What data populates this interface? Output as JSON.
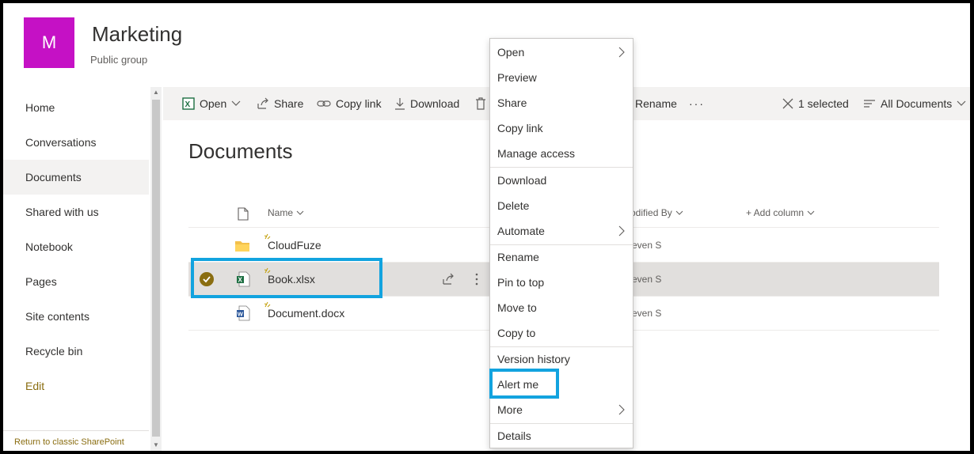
{
  "site": {
    "logo_letter": "M",
    "title": "Marketing",
    "subtitle": "Public group"
  },
  "nav": {
    "items": [
      {
        "label": "Home"
      },
      {
        "label": "Conversations"
      },
      {
        "label": "Documents",
        "active": true
      },
      {
        "label": "Shared with us"
      },
      {
        "label": "Notebook"
      },
      {
        "label": "Pages"
      },
      {
        "label": "Site contents"
      },
      {
        "label": "Recycle bin"
      },
      {
        "label": "Edit"
      }
    ],
    "classic_link": "Return to classic SharePoint"
  },
  "commandbar": {
    "open": "Open",
    "share": "Share",
    "copy_link": "Copy link",
    "download": "Download",
    "rename": "Rename",
    "more": "···",
    "selected": "1 selected",
    "view": "All Documents"
  },
  "library": {
    "title": "Documents",
    "columns": {
      "name": "Name",
      "modified_by": "odified By",
      "add_column": "+ Add column"
    },
    "rows": [
      {
        "name": "CloudFuze",
        "type": "folder",
        "modified_by": "even S"
      },
      {
        "name": "Book.xlsx",
        "type": "excel",
        "modified_by": "even S",
        "selected": true
      },
      {
        "name": "Document.docx",
        "type": "word",
        "modified_by": "even S"
      }
    ]
  },
  "context_menu": {
    "items": [
      {
        "label": "Open",
        "submenu": true
      },
      {
        "label": "Preview"
      },
      {
        "label": "Share"
      },
      {
        "label": "Copy link"
      },
      {
        "label": "Manage access"
      },
      {
        "label": "Download"
      },
      {
        "label": "Delete"
      },
      {
        "label": "Automate",
        "submenu": true
      },
      {
        "label": "Rename"
      },
      {
        "label": "Pin to top"
      },
      {
        "label": "Move to"
      },
      {
        "label": "Copy to"
      },
      {
        "label": "Version history"
      },
      {
        "label": "Alert me"
      },
      {
        "label": "More",
        "submenu": true
      },
      {
        "label": "Details"
      }
    ]
  },
  "colors": {
    "logo": "#c511c5",
    "accent": "#8a6d10",
    "highlight": "#12a3df",
    "excel": "#1d6f42",
    "word": "#2b579a",
    "folder": "#f3c04b"
  }
}
